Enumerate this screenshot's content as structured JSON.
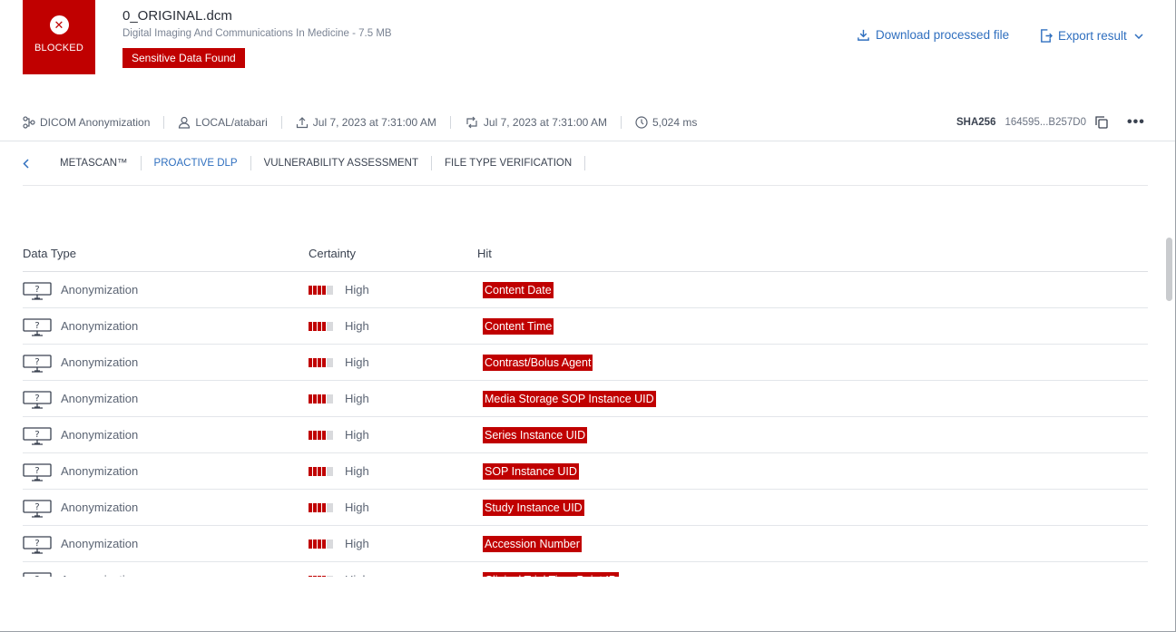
{
  "header": {
    "status_label": "BLOCKED",
    "file_name": "0_ORIGINAL.dcm",
    "file_description": "Digital Imaging And Communications In Medicine - 7.5 MB",
    "verdict_badge": "Sensitive Data Found",
    "download_label": "Download processed file",
    "export_label": "Export result"
  },
  "meta": {
    "workflow": "DICOM Anonymization",
    "user": "LOCAL/atabari",
    "uploaded": "Jul 7, 2023 at 7:31:00 AM",
    "processed": "Jul 7, 2023 at 7:31:00 AM",
    "duration": "5,024 ms",
    "sha_label": "SHA256",
    "sha_value": "164595...B257D0"
  },
  "tabs": [
    {
      "label": "METASCAN™",
      "active": false
    },
    {
      "label": "PROACTIVE DLP",
      "active": true
    },
    {
      "label": "VULNERABILITY ASSESSMENT",
      "active": false
    },
    {
      "label": "FILE TYPE VERIFICATION",
      "active": false
    }
  ],
  "table": {
    "headers": {
      "data_type": "Data Type",
      "certainty": "Certainty",
      "hit": "Hit"
    },
    "rows": [
      {
        "data_type": "Anonymization",
        "certainty": "High",
        "certainty_level": 0.8,
        "hit": "Content Date"
      },
      {
        "data_type": "Anonymization",
        "certainty": "High",
        "certainty_level": 0.8,
        "hit": "Content Time"
      },
      {
        "data_type": "Anonymization",
        "certainty": "High",
        "certainty_level": 0.8,
        "hit": "Contrast/Bolus Agent"
      },
      {
        "data_type": "Anonymization",
        "certainty": "High",
        "certainty_level": 0.8,
        "hit": "Media Storage SOP Instance UID"
      },
      {
        "data_type": "Anonymization",
        "certainty": "High",
        "certainty_level": 0.8,
        "hit": "Series Instance UID"
      },
      {
        "data_type": "Anonymization",
        "certainty": "High",
        "certainty_level": 0.8,
        "hit": "SOP Instance UID"
      },
      {
        "data_type": "Anonymization",
        "certainty": "High",
        "certainty_level": 0.8,
        "hit": "Study Instance UID"
      },
      {
        "data_type": "Anonymization",
        "certainty": "High",
        "certainty_level": 0.8,
        "hit": "Accession Number"
      },
      {
        "data_type": "Anonymization",
        "certainty": "High",
        "certainty_level": 0.8,
        "hit": "Clinical Trial Time Point ID"
      }
    ]
  },
  "colors": {
    "blocked": "#c00000",
    "link": "#2f6fbf"
  }
}
